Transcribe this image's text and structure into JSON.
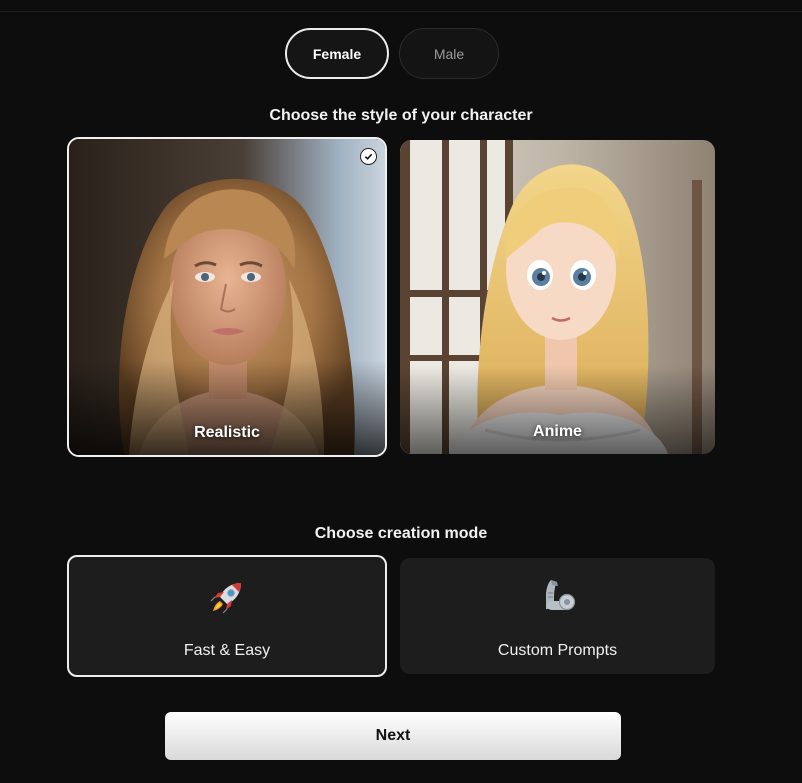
{
  "gender_toggle": {
    "female_label": "Female",
    "male_label": "Male",
    "selected": "Female"
  },
  "style_section": {
    "heading": "Choose the style of your character",
    "options": [
      {
        "label": "Realistic",
        "selected": true
      },
      {
        "label": "Anime",
        "selected": false
      }
    ]
  },
  "mode_section": {
    "heading": "Choose creation mode",
    "options": [
      {
        "label": "Fast & Easy",
        "icon": "rocket-icon",
        "selected": true
      },
      {
        "label": "Custom Prompts",
        "icon": "mechanical-arm-icon",
        "selected": false
      }
    ]
  },
  "next_button": {
    "label": "Next"
  },
  "colors": {
    "background": "#0d0d0d",
    "card": "#1d1d1d",
    "selected_border": "#f0f0f0"
  }
}
